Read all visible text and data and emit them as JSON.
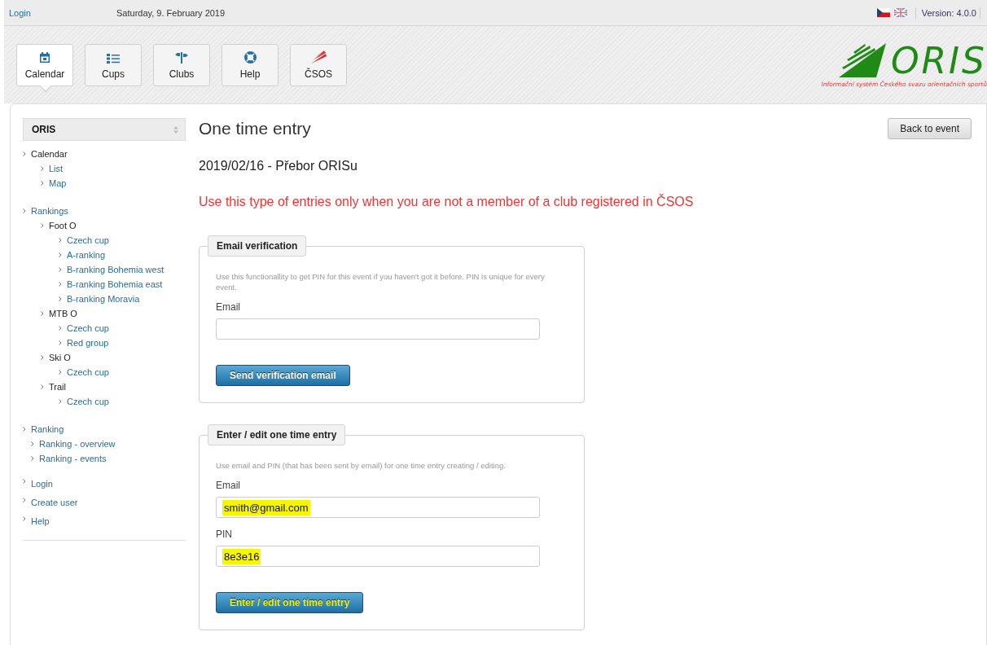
{
  "top_bar": {
    "login": "Login",
    "date": "Saturday, 9. February 2019",
    "version": "Version: 4.0.0"
  },
  "nav_tabs": [
    {
      "label": "Calendar",
      "selected": true
    },
    {
      "label": "Cups",
      "selected": false
    },
    {
      "label": "Clubs",
      "selected": false
    },
    {
      "label": "Help",
      "selected": false
    },
    {
      "label": "ČSOS",
      "selected": false
    }
  ],
  "logo": {
    "text": "ORIS",
    "tagline": "Informační systém Českého svazu orientačních sportů"
  },
  "sidebar": {
    "title": "ORIS",
    "groups": [
      [
        {
          "label": "Calendar",
          "kind": "heading",
          "children": [
            {
              "label": "List",
              "kind": "link"
            },
            {
              "label": "Map",
              "kind": "link"
            }
          ]
        }
      ],
      [
        {
          "label": "Rankings",
          "kind": "link",
          "children": [
            {
              "label": "Foot O",
              "kind": "heading",
              "children": [
                {
                  "label": "Czech cup",
                  "kind": "link"
                },
                {
                  "label": "A-ranking",
                  "kind": "link"
                },
                {
                  "label": "B-ranking Bohemia west",
                  "kind": "link"
                },
                {
                  "label": "B-ranking Bohemia east",
                  "kind": "link"
                },
                {
                  "label": "B-ranking Moravia",
                  "kind": "link"
                }
              ]
            },
            {
              "label": "MTB O",
              "kind": "heading",
              "children": [
                {
                  "label": "Czech cup",
                  "kind": "link"
                },
                {
                  "label": "Red group",
                  "kind": "link"
                }
              ]
            },
            {
              "label": "Ski O",
              "kind": "heading",
              "children": [
                {
                  "label": "Czech cup",
                  "kind": "link"
                }
              ]
            },
            {
              "label": "Trail",
              "kind": "heading",
              "children": [
                {
                  "label": "Czech cup",
                  "kind": "link"
                }
              ]
            }
          ]
        }
      ],
      [
        {
          "label": "Ranking",
          "kind": "link",
          "children": [
            {
              "label": "Ranking - overview",
              "kind": "link"
            },
            {
              "label": "Ranking - events",
              "kind": "link"
            }
          ]
        }
      ],
      [
        {
          "label": "Login",
          "kind": "link"
        },
        {
          "label": "Create user",
          "kind": "link"
        },
        {
          "label": "Help",
          "kind": "link"
        }
      ]
    ]
  },
  "page": {
    "title": "One time entry",
    "back_button": "Back to event",
    "event_title": "2019/02/16 - Přebor ORISu",
    "warning": "Use this type of entries only when you are not a member of a club registered in ČSOS",
    "panels": [
      {
        "legend": "Email verification",
        "hint": "Use this functionallity to get PIN for this event if you haven't got it before. PIN is unique for every event.",
        "fields": [
          {
            "label": "Email"
          }
        ],
        "button": {
          "label": "Send verification email",
          "highlighted": false
        }
      },
      {
        "legend": "Enter / edit one time entry",
        "hint": "Use email and PIN (that has been sent by email) for one time entry creating / editing.",
        "fields": [
          {
            "label": "Email",
            "value": "smith@gmail.com",
            "highlighted": true
          },
          {
            "label": "PIN",
            "value": "8e3e16",
            "highlighted": true
          }
        ],
        "button": {
          "label": "Enter / edit one time entry",
          "highlighted": true
        }
      }
    ]
  }
}
